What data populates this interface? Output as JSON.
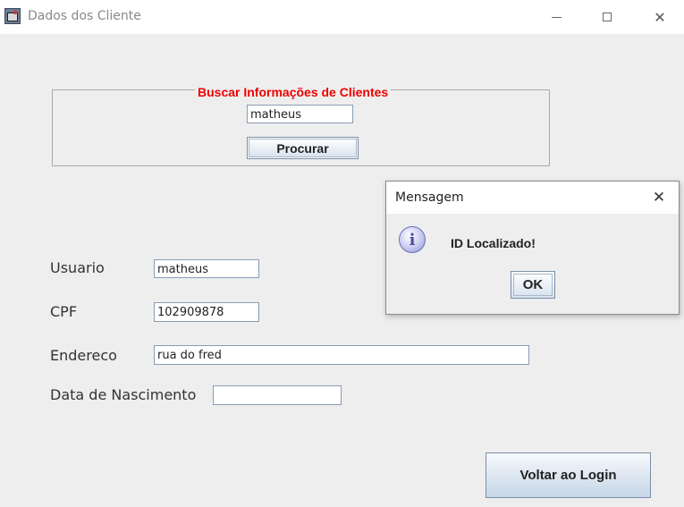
{
  "window": {
    "title": "Dados dos Cliente"
  },
  "search": {
    "legend": "Buscar Informações de Clientes",
    "query_value": "matheus",
    "button_label": "Procurar"
  },
  "form": {
    "usuario_label": "Usuario",
    "usuario_value": "matheus",
    "cpf_label": "CPF",
    "cpf_value": "102909878",
    "endereco_label": "Endereco",
    "endereco_value": "rua do fred",
    "nascimento_label": "Data de Nascimento",
    "nascimento_value": ""
  },
  "actions": {
    "back_label": "Voltar ao Login"
  },
  "dialog": {
    "title": "Mensagem",
    "message": "ID Localizado!",
    "ok_label": "OK",
    "icon": "info-icon"
  },
  "colors": {
    "legend": "#ee0000",
    "background": "#eeeeee"
  }
}
